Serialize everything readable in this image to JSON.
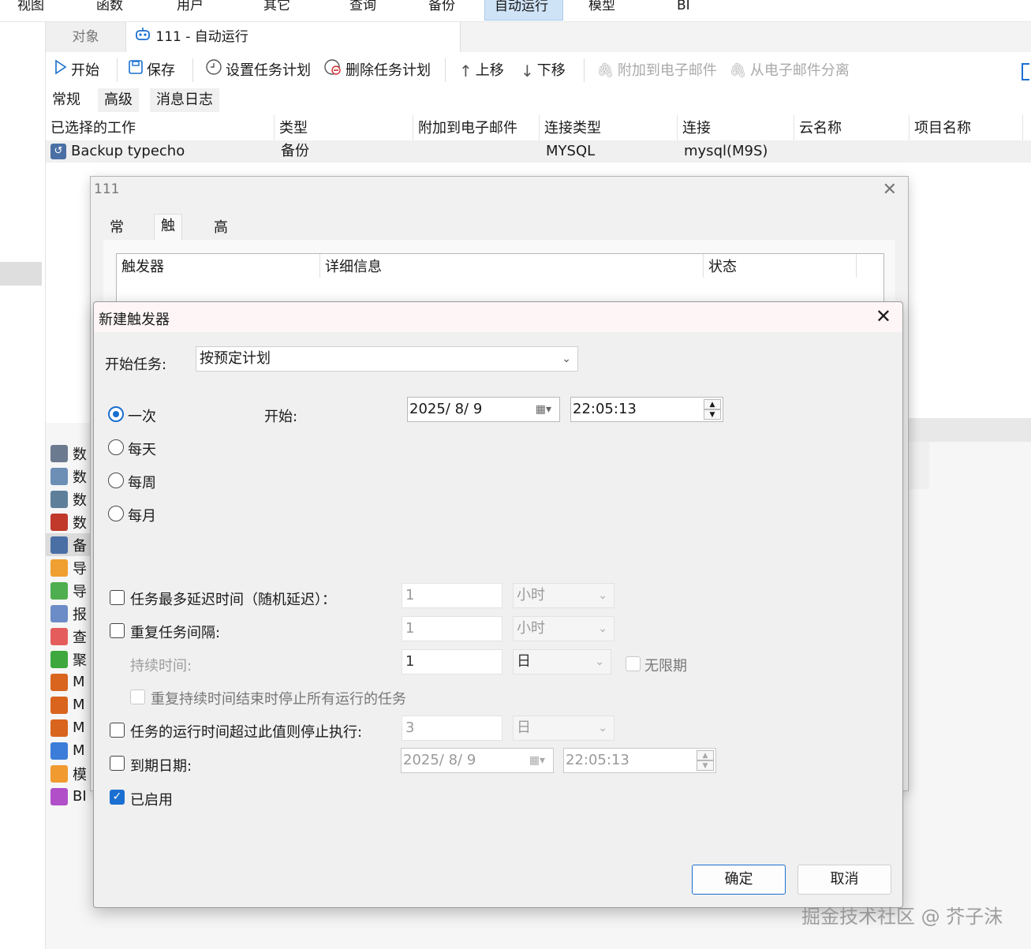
{
  "menu": [
    "视图",
    "函数",
    "用户",
    "其它",
    "查询",
    "备份",
    "自动运行",
    "模型",
    "BI"
  ],
  "tabs": {
    "object": "对象",
    "current": "111 - 自动运行"
  },
  "toolbar": {
    "start": "开始",
    "save": "保存",
    "set_schedule": "设置任务计划",
    "delete_schedule": "删除任务计划",
    "move_up": "上移",
    "move_down": "下移",
    "attach_email": "附加到电子邮件",
    "detach_email": "从电子邮件分离"
  },
  "subtabs": [
    "常规",
    "高级",
    "消息日志"
  ],
  "jobs": {
    "headers": [
      "已选择的工作",
      "类型",
      "附加到电子邮件",
      "连接类型",
      "连接",
      "云名称",
      "项目名称"
    ],
    "rows": [
      {
        "name": "Backup typecho",
        "type": "备份",
        "email": "",
        "conn_type": "MYSQL",
        "conn": "mysql(M9S)",
        "cloud": "",
        "project": ""
      }
    ]
  },
  "objects": [
    "数",
    "数",
    "数",
    "数",
    "备",
    "导",
    "导",
    "报",
    "查",
    "聚",
    "M",
    "M",
    "M",
    "M",
    "模",
    "BI"
  ],
  "dialog_schedule": {
    "title": "111",
    "tabs": [
      "常规",
      "触发器",
      "高级"
    ],
    "table_headers": [
      "触发器",
      "详细信息",
      "状态"
    ]
  },
  "dialog_trigger": {
    "title": "新建触发器",
    "start_task_label": "开始任务:",
    "start_task_value": "按预定计划",
    "radios": [
      "一次",
      "每天",
      "每周",
      "每月"
    ],
    "start_label": "开始:",
    "start_date": "2025/  8/  9",
    "start_time": "22:05:13",
    "delay": {
      "label": "任务最多延迟时间（随机延迟）：",
      "value": "1",
      "unit": "小时"
    },
    "repeat": {
      "label": "重复任务间隔:",
      "value": "1",
      "unit": "小时"
    },
    "duration": {
      "label": "持续时间:",
      "value": "1",
      "unit": "日",
      "indefinite": "无限期"
    },
    "stop_all_label": "重复持续时间结束时停止所有运行的任务",
    "stop_if": {
      "label": "任务的运行时间超过此值则停止执行:",
      "value": "3",
      "unit": "日"
    },
    "expire": {
      "label": "到期日期:",
      "date": "2025/  8/  9",
      "time": "22:05:13"
    },
    "enabled_label": "已启用",
    "ok": "确定",
    "cancel": "取消"
  },
  "watermark": "掘金技术社区 @ 芥子沫",
  "colors": {
    "accent": "#1a6fd0",
    "menu_active": "#cfe3f7",
    "title_tint": "#fdf5f6"
  }
}
